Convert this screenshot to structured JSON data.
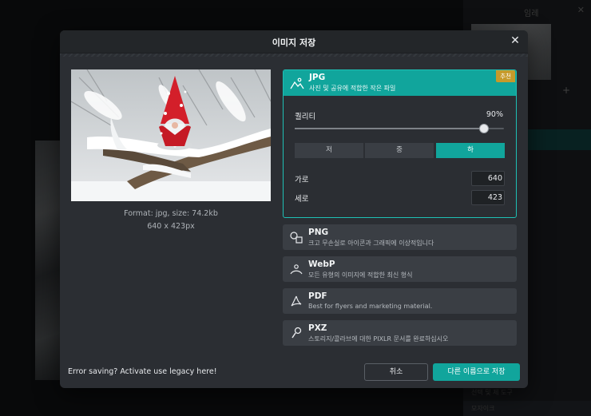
{
  "background": {
    "layer_panel_title": "임레",
    "bottom_items": [
      "선택 및 제 도구",
      "모자이크"
    ]
  },
  "dialog": {
    "title": "이미지 저장",
    "preview_info": {
      "format_line": "Format: jpg, size: 74.2kb",
      "dims_line": "640 x 423px"
    },
    "selected_format": {
      "name": "JPG",
      "description": "사진 및 공유에 적합한 작은 파일",
      "badge": "추천",
      "icon": "image-icon",
      "quality_label": "퀄리티",
      "quality_value": "90%",
      "quality_fraction": 0.9,
      "presets": [
        {
          "label": "저",
          "active": false
        },
        {
          "label": "중",
          "active": false
        },
        {
          "label": "하",
          "active": true
        }
      ],
      "width_label": "가로",
      "width_value": "640",
      "height_label": "세로",
      "height_value": "423"
    },
    "formats": [
      {
        "name": "PNG",
        "description": "크고 무손실로 아이콘과 그래픽에 이상적입니다",
        "icon": "shapes-icon"
      },
      {
        "name": "WebP",
        "description": "모든 유형의 이미지에 적합한 최신 형식",
        "icon": "webp-icon"
      },
      {
        "name": "PDF",
        "description": "Best for flyers and marketing material.",
        "icon": "pdf-icon"
      },
      {
        "name": "PXZ",
        "description": "스토리지/콜라브에 대한 PIXLR 문서를 완료하십시오",
        "icon": "pxz-icon"
      }
    ],
    "legacy_text": "Error saving? Activate use legacy here!",
    "cancel_label": "취소",
    "save_as_label": "다른 이름으로 저장"
  },
  "colors": {
    "accent": "#11a59c",
    "badge": "#c69a2a",
    "dialog_bg": "#2b2e33"
  }
}
